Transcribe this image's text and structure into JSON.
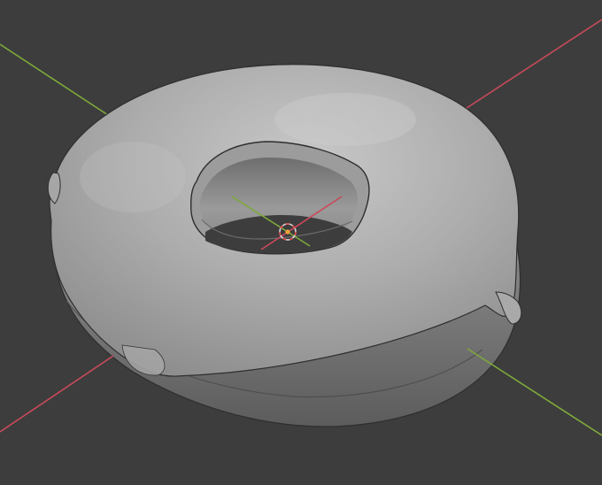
{
  "viewport": {
    "background_color": "#3d3d3d",
    "x_axis_color": "#c94a5a",
    "y_axis_color": "#7ea83a",
    "mesh_base_color": "#9a9a9a",
    "mesh_highlight_color": "#c4c4c4",
    "mesh_shadow_color": "#5a5a5a",
    "mesh_edge_color": "#2e2e2e",
    "origin_icon": "origin-marker-icon",
    "origin_ring_color": "#d8d8d8",
    "origin_fill_color": "#f2a33a",
    "origin_dash_color": "#e04848",
    "object": "donut-mesh-with-icing"
  }
}
